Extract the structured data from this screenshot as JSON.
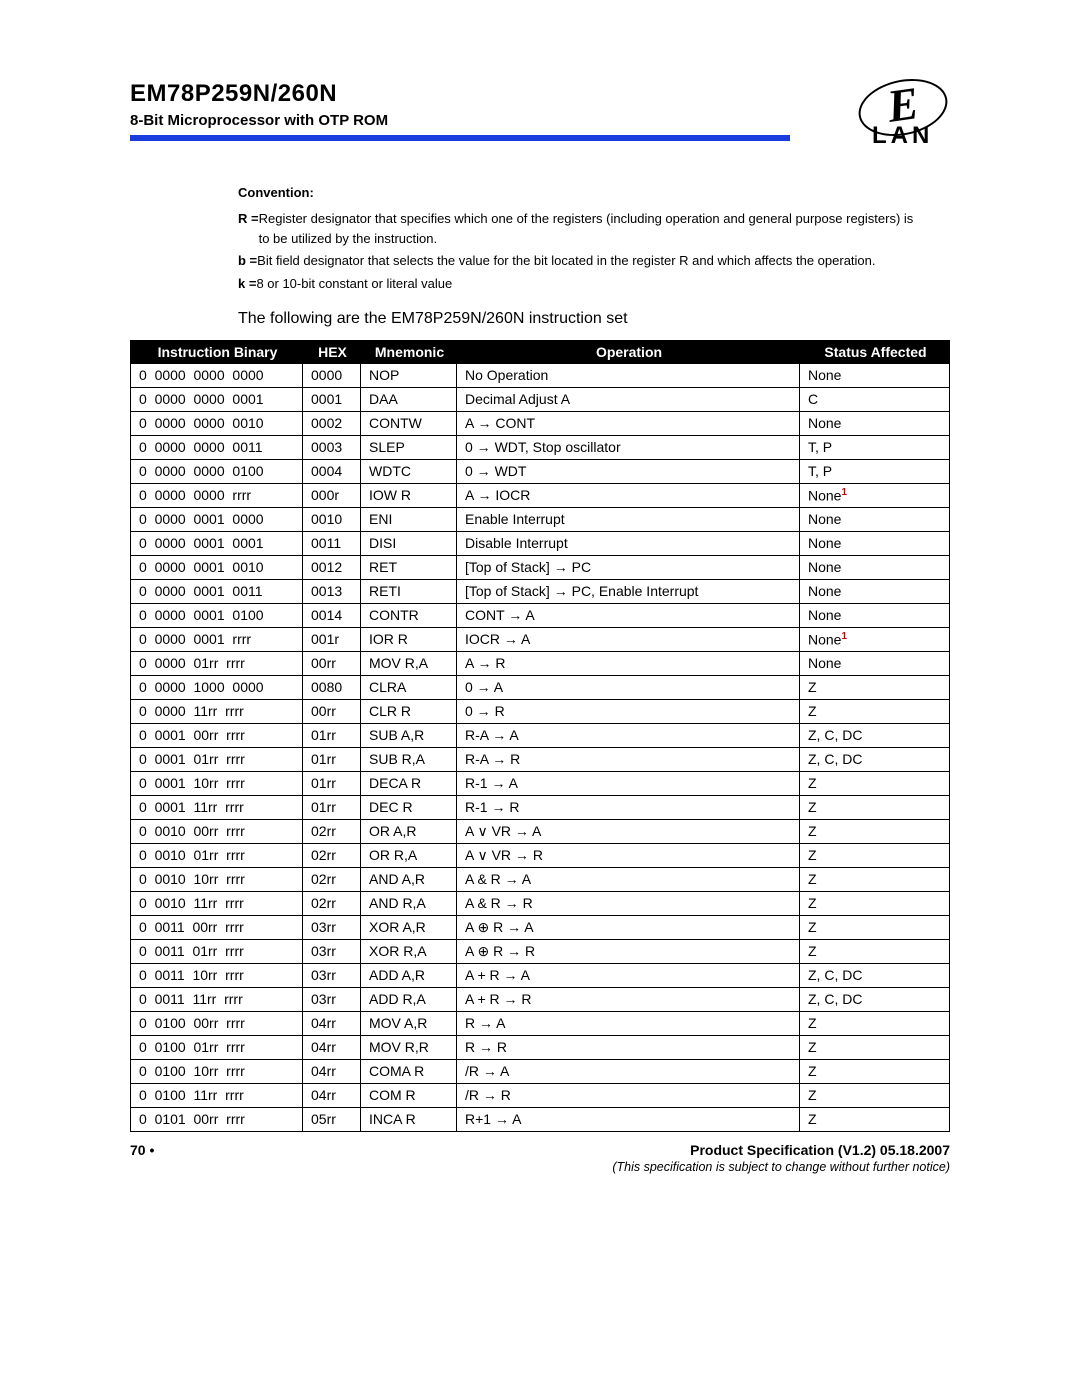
{
  "header": {
    "title": "EM78P259N/260N",
    "subtitle": "8-Bit Microprocessor with OTP ROM",
    "logo_script": "E",
    "logo_lan": "LAN"
  },
  "convention": {
    "heading": "Convention:",
    "r_lead": "R = ",
    "r_text": "Register designator that specifies which one of the registers (including operation and general purpose registers) is to be utilized by the instruction.",
    "b_lead": "b = ",
    "b_text": "Bit field designator that selects the value for the bit located in the register R and which affects the operation.",
    "k_lead": "k = ",
    "k_text": "8 or 10-bit constant or literal value"
  },
  "leadin": "The following are the EM78P259N/260N instruction set",
  "table": {
    "headers": {
      "binary": "Instruction Binary",
      "hex": "HEX",
      "mnemonic": "Mnemonic",
      "operation": "Operation",
      "status": "Status Affected"
    },
    "rows": [
      {
        "b": "0  0000  0000  0000",
        "h": "0000",
        "m": "NOP",
        "o": "No Operation",
        "s": "None",
        "sup": false
      },
      {
        "b": "0  0000  0000  0001",
        "h": "0001",
        "m": "DAA",
        "o": "Decimal Adjust A",
        "s": "C",
        "sup": false
      },
      {
        "b": "0  0000  0000  0010",
        "h": "0002",
        "m": "CONTW",
        "o": "A → CONT",
        "s": "None",
        "sup": false
      },
      {
        "b": "0  0000  0000  0011",
        "h": "0003",
        "m": "SLEP",
        "o": "0 → WDT, Stop oscillator",
        "s": "T, P",
        "sup": false
      },
      {
        "b": "0  0000  0000  0100",
        "h": "0004",
        "m": "WDTC",
        "o": "0 → WDT",
        "s": "T, P",
        "sup": false
      },
      {
        "b": "0  0000  0000  rrrr",
        "h": "000r",
        "m": "IOW R",
        "o": "A → IOCR",
        "s": "None",
        "sup": true
      },
      {
        "b": "0  0000  0001  0000",
        "h": "0010",
        "m": "ENI",
        "o": "Enable Interrupt",
        "s": "None",
        "sup": false
      },
      {
        "b": "0  0000  0001  0001",
        "h": "0011",
        "m": "DISI",
        "o": "Disable Interrupt",
        "s": "None",
        "sup": false
      },
      {
        "b": "0  0000  0001  0010",
        "h": "0012",
        "m": "RET",
        "o": "[Top of Stack] → PC",
        "s": "None",
        "sup": false
      },
      {
        "b": "0  0000  0001  0011",
        "h": "0013",
        "m": "RETI",
        "o": "[Top of Stack] → PC, Enable Interrupt",
        "s": "None",
        "sup": false
      },
      {
        "b": "0  0000  0001  0100",
        "h": "0014",
        "m": "CONTR",
        "o": "CONT → A",
        "s": "None",
        "sup": false
      },
      {
        "b": "0  0000  0001  rrrr",
        "h": "001r",
        "m": "IOR R",
        "o": "IOCR → A",
        "s": "None",
        "sup": true
      },
      {
        "b": "0  0000  01rr  rrrr",
        "h": "00rr",
        "m": "MOV R,A",
        "o": "A → R",
        "s": "None",
        "sup": false
      },
      {
        "b": "0  0000  1000  0000",
        "h": "0080",
        "m": "CLRA",
        "o": "0 → A",
        "s": "Z",
        "sup": false
      },
      {
        "b": "0  0000  11rr  rrrr",
        "h": "00rr",
        "m": "CLR R",
        "o": "0 → R",
        "s": "Z",
        "sup": false
      },
      {
        "b": "0  0001  00rr  rrrr",
        "h": "01rr",
        "m": "SUB A,R",
        "o": "R-A → A",
        "s": "Z, C, DC",
        "sup": false
      },
      {
        "b": "0  0001  01rr  rrrr",
        "h": "01rr",
        "m": "SUB R,A",
        "o": "R-A → R",
        "s": "Z, C, DC",
        "sup": false
      },
      {
        "b": "0  0001  10rr  rrrr",
        "h": "01rr",
        "m": "DECA R",
        "o": "R-1 → A",
        "s": "Z",
        "sup": false
      },
      {
        "b": "0  0001  11rr  rrrr",
        "h": "01rr",
        "m": "DEC R",
        "o": "R-1 → R",
        "s": "Z",
        "sup": false
      },
      {
        "b": "0  0010  00rr  rrrr",
        "h": "02rr",
        "m": "OR A,R",
        "o": "A ∨ VR → A",
        "s": "Z",
        "sup": false
      },
      {
        "b": "0  0010  01rr  rrrr",
        "h": "02rr",
        "m": "OR R,A",
        "o": "A ∨ VR → R",
        "s": "Z",
        "sup": false
      },
      {
        "b": "0  0010  10rr  rrrr",
        "h": "02rr",
        "m": "AND A,R",
        "o": "A & R → A",
        "s": "Z",
        "sup": false
      },
      {
        "b": "0  0010  11rr  rrrr",
        "h": "02rr",
        "m": "AND R,A",
        "o": "A & R → R",
        "s": "Z",
        "sup": false
      },
      {
        "b": "0  0011  00rr  rrrr",
        "h": "03rr",
        "m": "XOR A,R",
        "o": "A ⊕ R → A",
        "s": "Z",
        "sup": false
      },
      {
        "b": "0  0011  01rr  rrrr",
        "h": "03rr",
        "m": "XOR R,A",
        "o": "A ⊕ R → R",
        "s": "Z",
        "sup": false
      },
      {
        "b": "0  0011  10rr  rrrr",
        "h": "03rr",
        "m": "ADD A,R",
        "o": "A + R → A",
        "s": "Z, C, DC",
        "sup": false
      },
      {
        "b": "0  0011  11rr  rrrr",
        "h": "03rr",
        "m": "ADD R,A",
        "o": "A + R → R",
        "s": "Z, C, DC",
        "sup": false
      },
      {
        "b": "0  0100  00rr  rrrr",
        "h": "04rr",
        "m": "MOV A,R",
        "o": "R → A",
        "s": "Z",
        "sup": false
      },
      {
        "b": "0  0100  01rr  rrrr",
        "h": "04rr",
        "m": "MOV R,R",
        "o": "R → R",
        "s": "Z",
        "sup": false
      },
      {
        "b": "0  0100  10rr  rrrr",
        "h": "04rr",
        "m": "COMA R",
        "o": "/R → A",
        "s": "Z",
        "sup": false
      },
      {
        "b": "0  0100  11rr  rrrr",
        "h": "04rr",
        "m": "COM R",
        "o": "/R → R",
        "s": "Z",
        "sup": false
      },
      {
        "b": "0  0101  00rr  rrrr",
        "h": "05rr",
        "m": "INCA R",
        "o": "R+1 → A",
        "s": "Z",
        "sup": false
      }
    ]
  },
  "footer": {
    "page": "70 •",
    "spec": "Product Specification (V1.2) 05.18.2007",
    "note": "(This specification is subject to change without further notice)"
  }
}
